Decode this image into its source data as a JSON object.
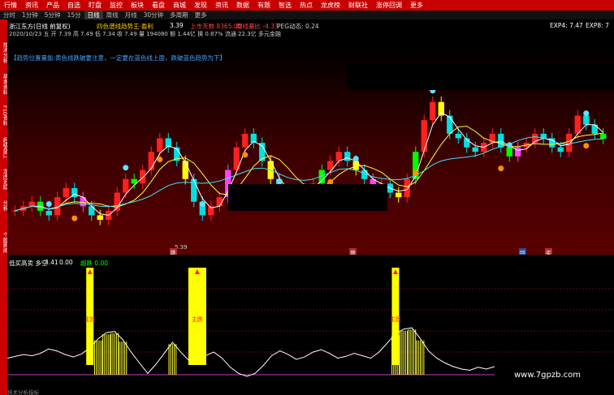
{
  "menu_items": [
    "行情",
    "资讯",
    "产品",
    "自选",
    "盯盘",
    "监控",
    "板块",
    "看盘",
    "商城",
    "发现",
    "资讯",
    "数据",
    "有题",
    "智选",
    "热点",
    "龙虎榜",
    "财联社",
    "涨停回调",
    "更多"
  ],
  "period_items": [
    "分时",
    "1分钟",
    "5分钟",
    "15分",
    "日线",
    "周线",
    "月线",
    "30分钟",
    "多周期",
    "更多"
  ],
  "selected_period": "日线",
  "stock_title": "浙江东方(日线 前复权)",
  "indicator_title": "四色谱线趋势王·盈利",
  "price_line": "2020/10/23 五 开 7.39 高 7.49 低 7.34 收 7.49 量 194080 额 1.44亿 换 0.87% 流通 22.3亿 多元金融",
  "indicator_values": [
    "3.39",
    "上市天数 8365.00",
    "周线量比 -4.33",
    "PEG动态: 0.24"
  ],
  "exp_labels": [
    "EXP4: 7.47",
    "EXP8: 7"
  ],
  "note_text": "【趋势位置量能:黄色线跌破要注意，一定要在蓝色线上面，跌破蓝色趋势为下】",
  "side_tabs": [
    "技术分析",
    "基本资料",
    "F10资料",
    "超级盘口",
    "龙虎追踪",
    "分析",
    "个股新闻"
  ],
  "price_annotation": "5.39",
  "price_markers": [
    "跌",
    "增",
    "回",
    "买"
  ],
  "lower_title": "低买高卖 多空",
  "lower_values": [
    "3.41",
    "0.00"
  ],
  "lower_extra": "超跌 0.00",
  "buy_label": "主跌",
  "watermark": "www.7gpzb.com",
  "bottom_tab": "技术分析指标",
  "colors": {
    "up": "#ff2020",
    "down": "#00e0e0",
    "yellow": "#ffff00",
    "menu": "#c80000",
    "magenta": "#ff40ff",
    "green": "#00ff00"
  },
  "chart_data": {
    "type": "candlestick",
    "note": "daily K-line with moving averages (white, yellow, cyan) and a buy/sell oscillator below",
    "close_series": [
      5.9,
      6.0,
      6.1,
      5.9,
      5.8,
      6.2,
      6.4,
      6.2,
      6.0,
      5.8,
      5.7,
      5.9,
      6.3,
      6.6,
      6.5,
      6.8,
      7.2,
      7.5,
      7.3,
      7.0,
      6.6,
      6.1,
      5.8,
      6.0,
      6.2,
      6.8,
      7.3,
      7.6,
      7.4,
      7.0,
      6.6,
      6.3,
      6.2,
      6.3,
      6.4,
      6.5,
      6.8,
      7.0,
      7.2,
      7.0,
      6.8,
      6.6,
      6.4,
      6.5,
      6.3,
      6.2,
      6.6,
      7.2,
      7.9,
      8.3,
      8.0,
      7.6,
      7.5,
      7.3,
      7.2,
      7.4,
      7.6,
      7.3,
      7.1,
      7.3,
      7.4,
      7.6,
      7.5,
      7.3,
      7.2,
      7.6,
      8.0,
      7.8,
      7.6,
      7.49
    ],
    "oscillator": [
      0.3,
      0.33,
      0.36,
      0.34,
      0.38,
      0.45,
      0.42,
      0.36,
      0.32,
      0.37,
      0.47,
      0.62,
      0.72,
      0.74,
      0.6,
      0.4,
      0.22,
      0.05,
      0.2,
      0.38,
      0.56,
      0.4,
      0.26,
      0.2,
      0.34,
      0.4,
      0.3,
      0.15,
      0.05,
      0.0,
      0.05,
      0.18,
      0.34,
      0.42,
      0.36,
      0.28,
      0.32,
      0.4,
      0.44,
      0.38,
      0.3,
      0.33,
      0.38,
      0.34,
      0.3,
      0.4,
      0.55,
      0.7,
      0.78,
      0.8,
      0.62,
      0.42,
      0.3,
      0.22,
      0.16,
      0.12,
      0.1,
      0.15,
      0.12,
      0.16
    ],
    "buy_signal_indices": [
      10,
      23,
      47
    ]
  }
}
